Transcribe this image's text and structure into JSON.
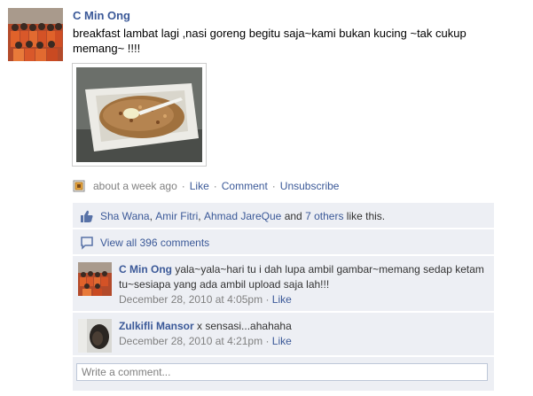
{
  "post": {
    "author": "C Min Ong",
    "text": "breakfast lambat lagi ,nasi goreng begitu saja~kami bukan kucing ~tak cukup memang~ !!!!",
    "time": "about a week ago",
    "actions": {
      "like": "Like",
      "comment": "Comment",
      "unsubscribe": "Unsubscribe"
    },
    "separator": "·"
  },
  "likes": {
    "people": [
      "Sha Wana",
      "Amir Fitri",
      "Ahmad JareQue"
    ],
    "comma": ",",
    "and_word": "and",
    "others_link": "7 others",
    "suffix": "like this."
  },
  "view_all": "View all 396 comments",
  "comments": [
    {
      "author": "C Min Ong",
      "text": "yala~yala~hari tu i dah lupa ambil gambar~memang sedap ketam tu~sesiapa yang ada ambil upload saja lah!!!",
      "time": "December 28, 2010 at 4:05pm",
      "like": "Like"
    },
    {
      "author": "Zulkifli Mansor",
      "text": "x sensasi...ahahaha",
      "time": "December 28, 2010 at 4:21pm",
      "like": "Like"
    }
  ],
  "write_comment": {
    "placeholder": "Write a comment..."
  },
  "colors": {
    "link": "#3b5998",
    "panel_bg": "#edeff4",
    "muted": "#808080"
  },
  "icons": {
    "status": "status-update-icon",
    "thumbs_up": "thumbs-up-icon",
    "comment": "comment-bubble-icon"
  }
}
